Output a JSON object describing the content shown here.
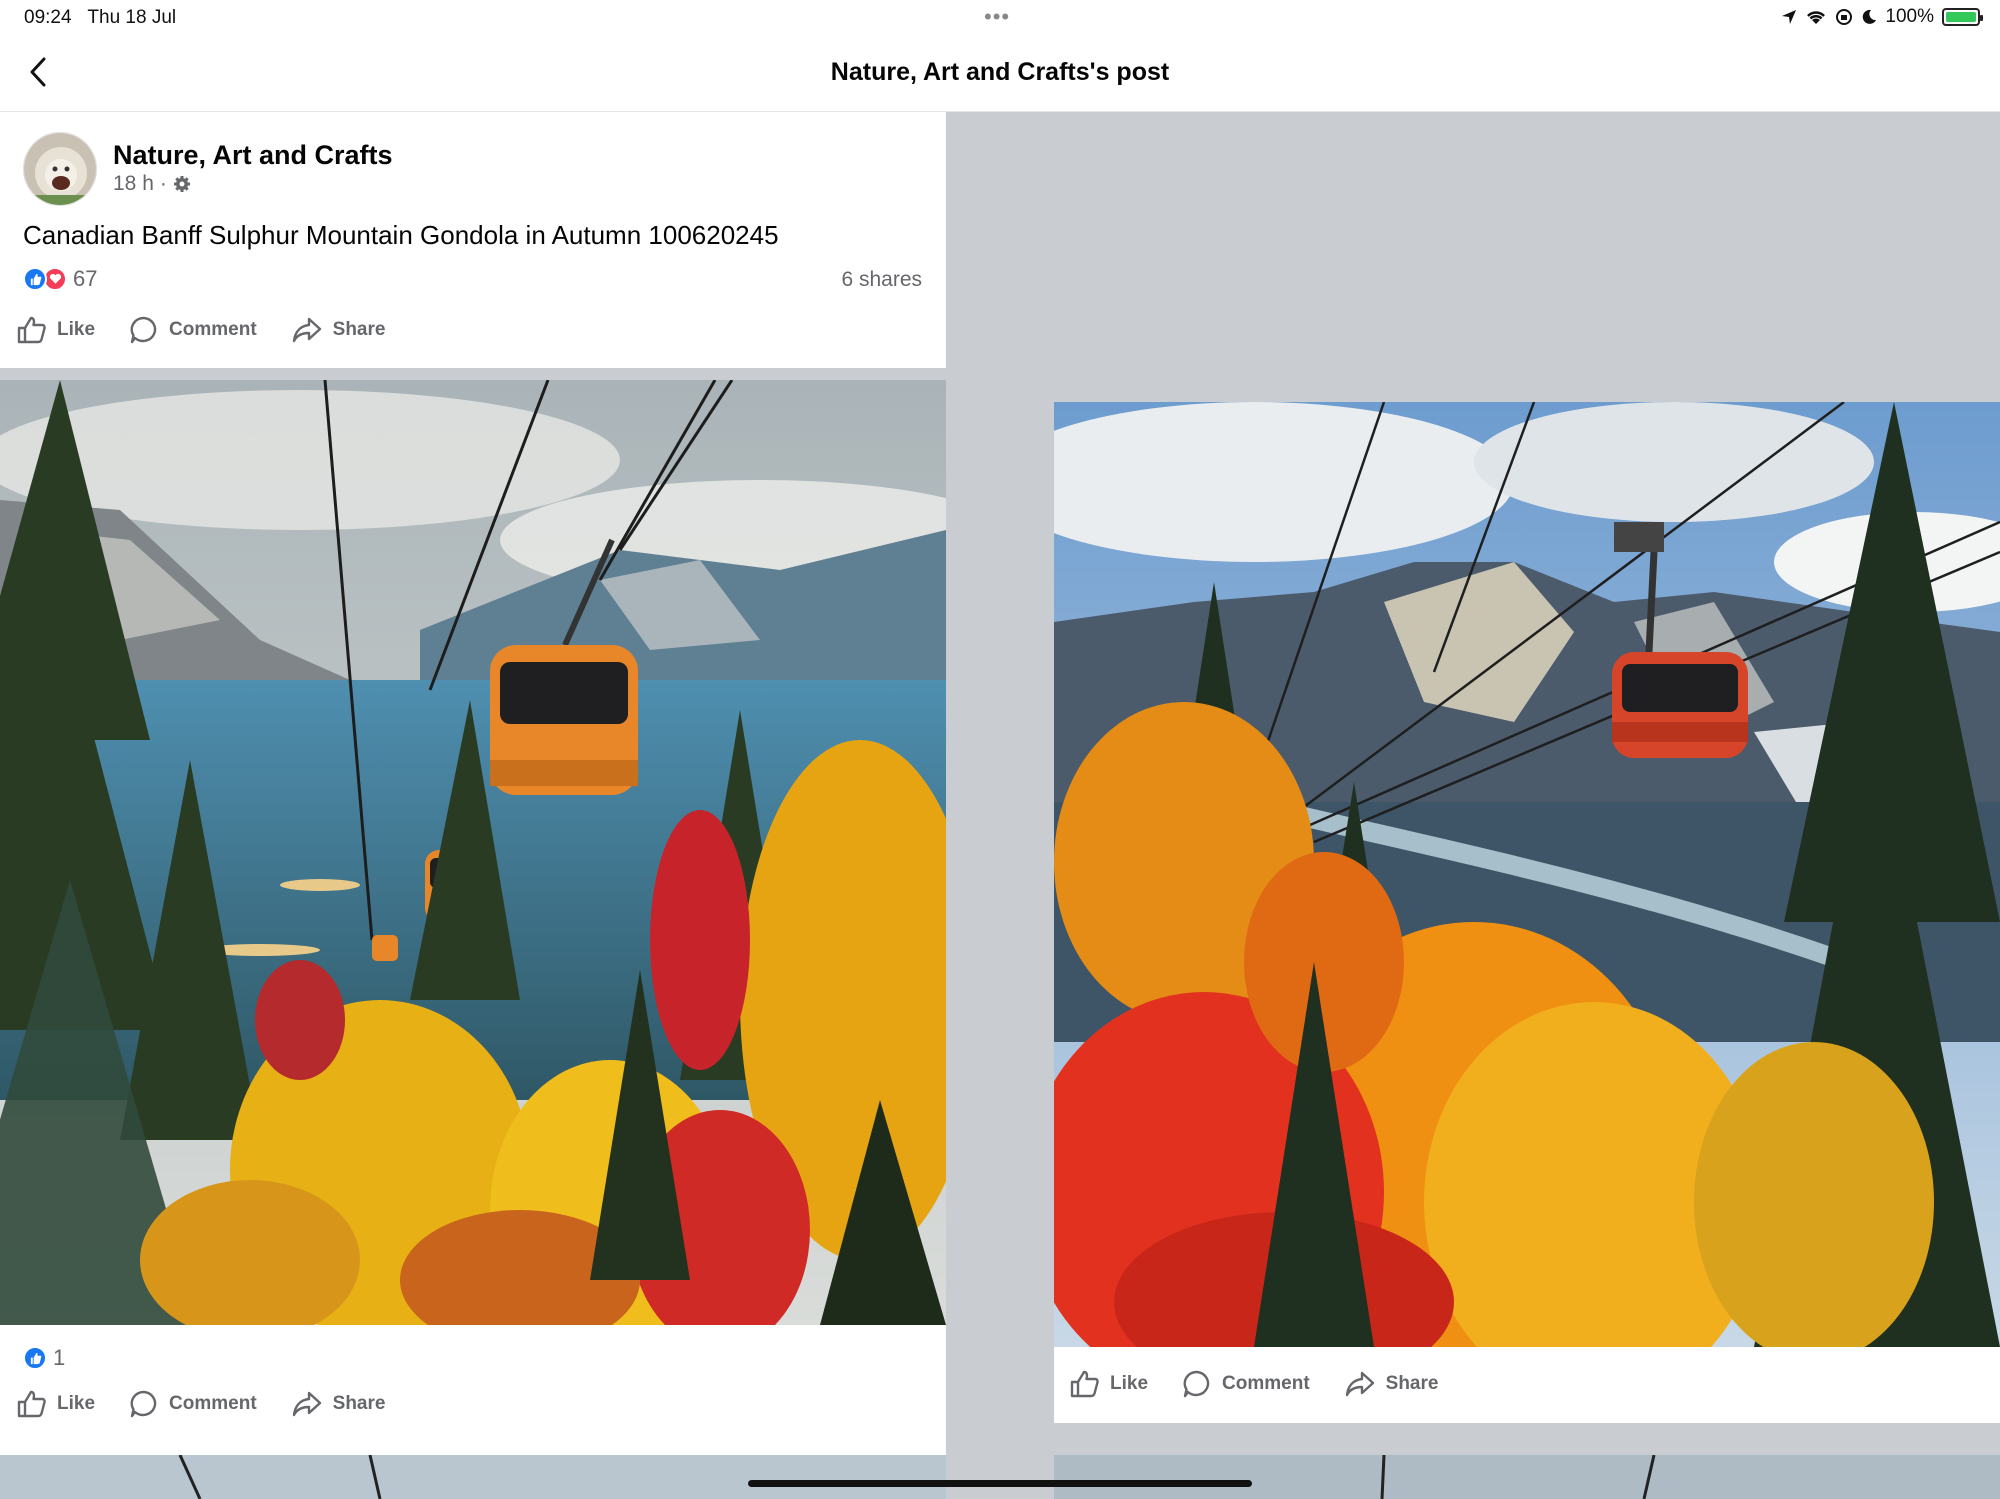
{
  "status": {
    "time": "09:24",
    "date": "Thu 18 Jul",
    "battery": "100%",
    "dots": "•••"
  },
  "header": {
    "title": "Nature, Art and Crafts's post",
    "back_icon": "chevron-left-icon"
  },
  "post": {
    "author": "Nature, Art and Crafts",
    "time": "18 h",
    "separator": "·",
    "privacy_icon": "gear-icon",
    "text": "Canadian Banff Sulphur Mountain Gondola in Autumn 100620245",
    "reactions_count": "67",
    "shares": "6 shares"
  },
  "actions": {
    "like": "Like",
    "comment": "Comment",
    "share": "Share"
  },
  "photo1": {
    "reactions_count": "1"
  },
  "colors": {
    "facebook_blue": "#1877f2",
    "love_red": "#f33e58",
    "divider_gray": "#c9ccd1",
    "secondary_text": "#65676b"
  }
}
